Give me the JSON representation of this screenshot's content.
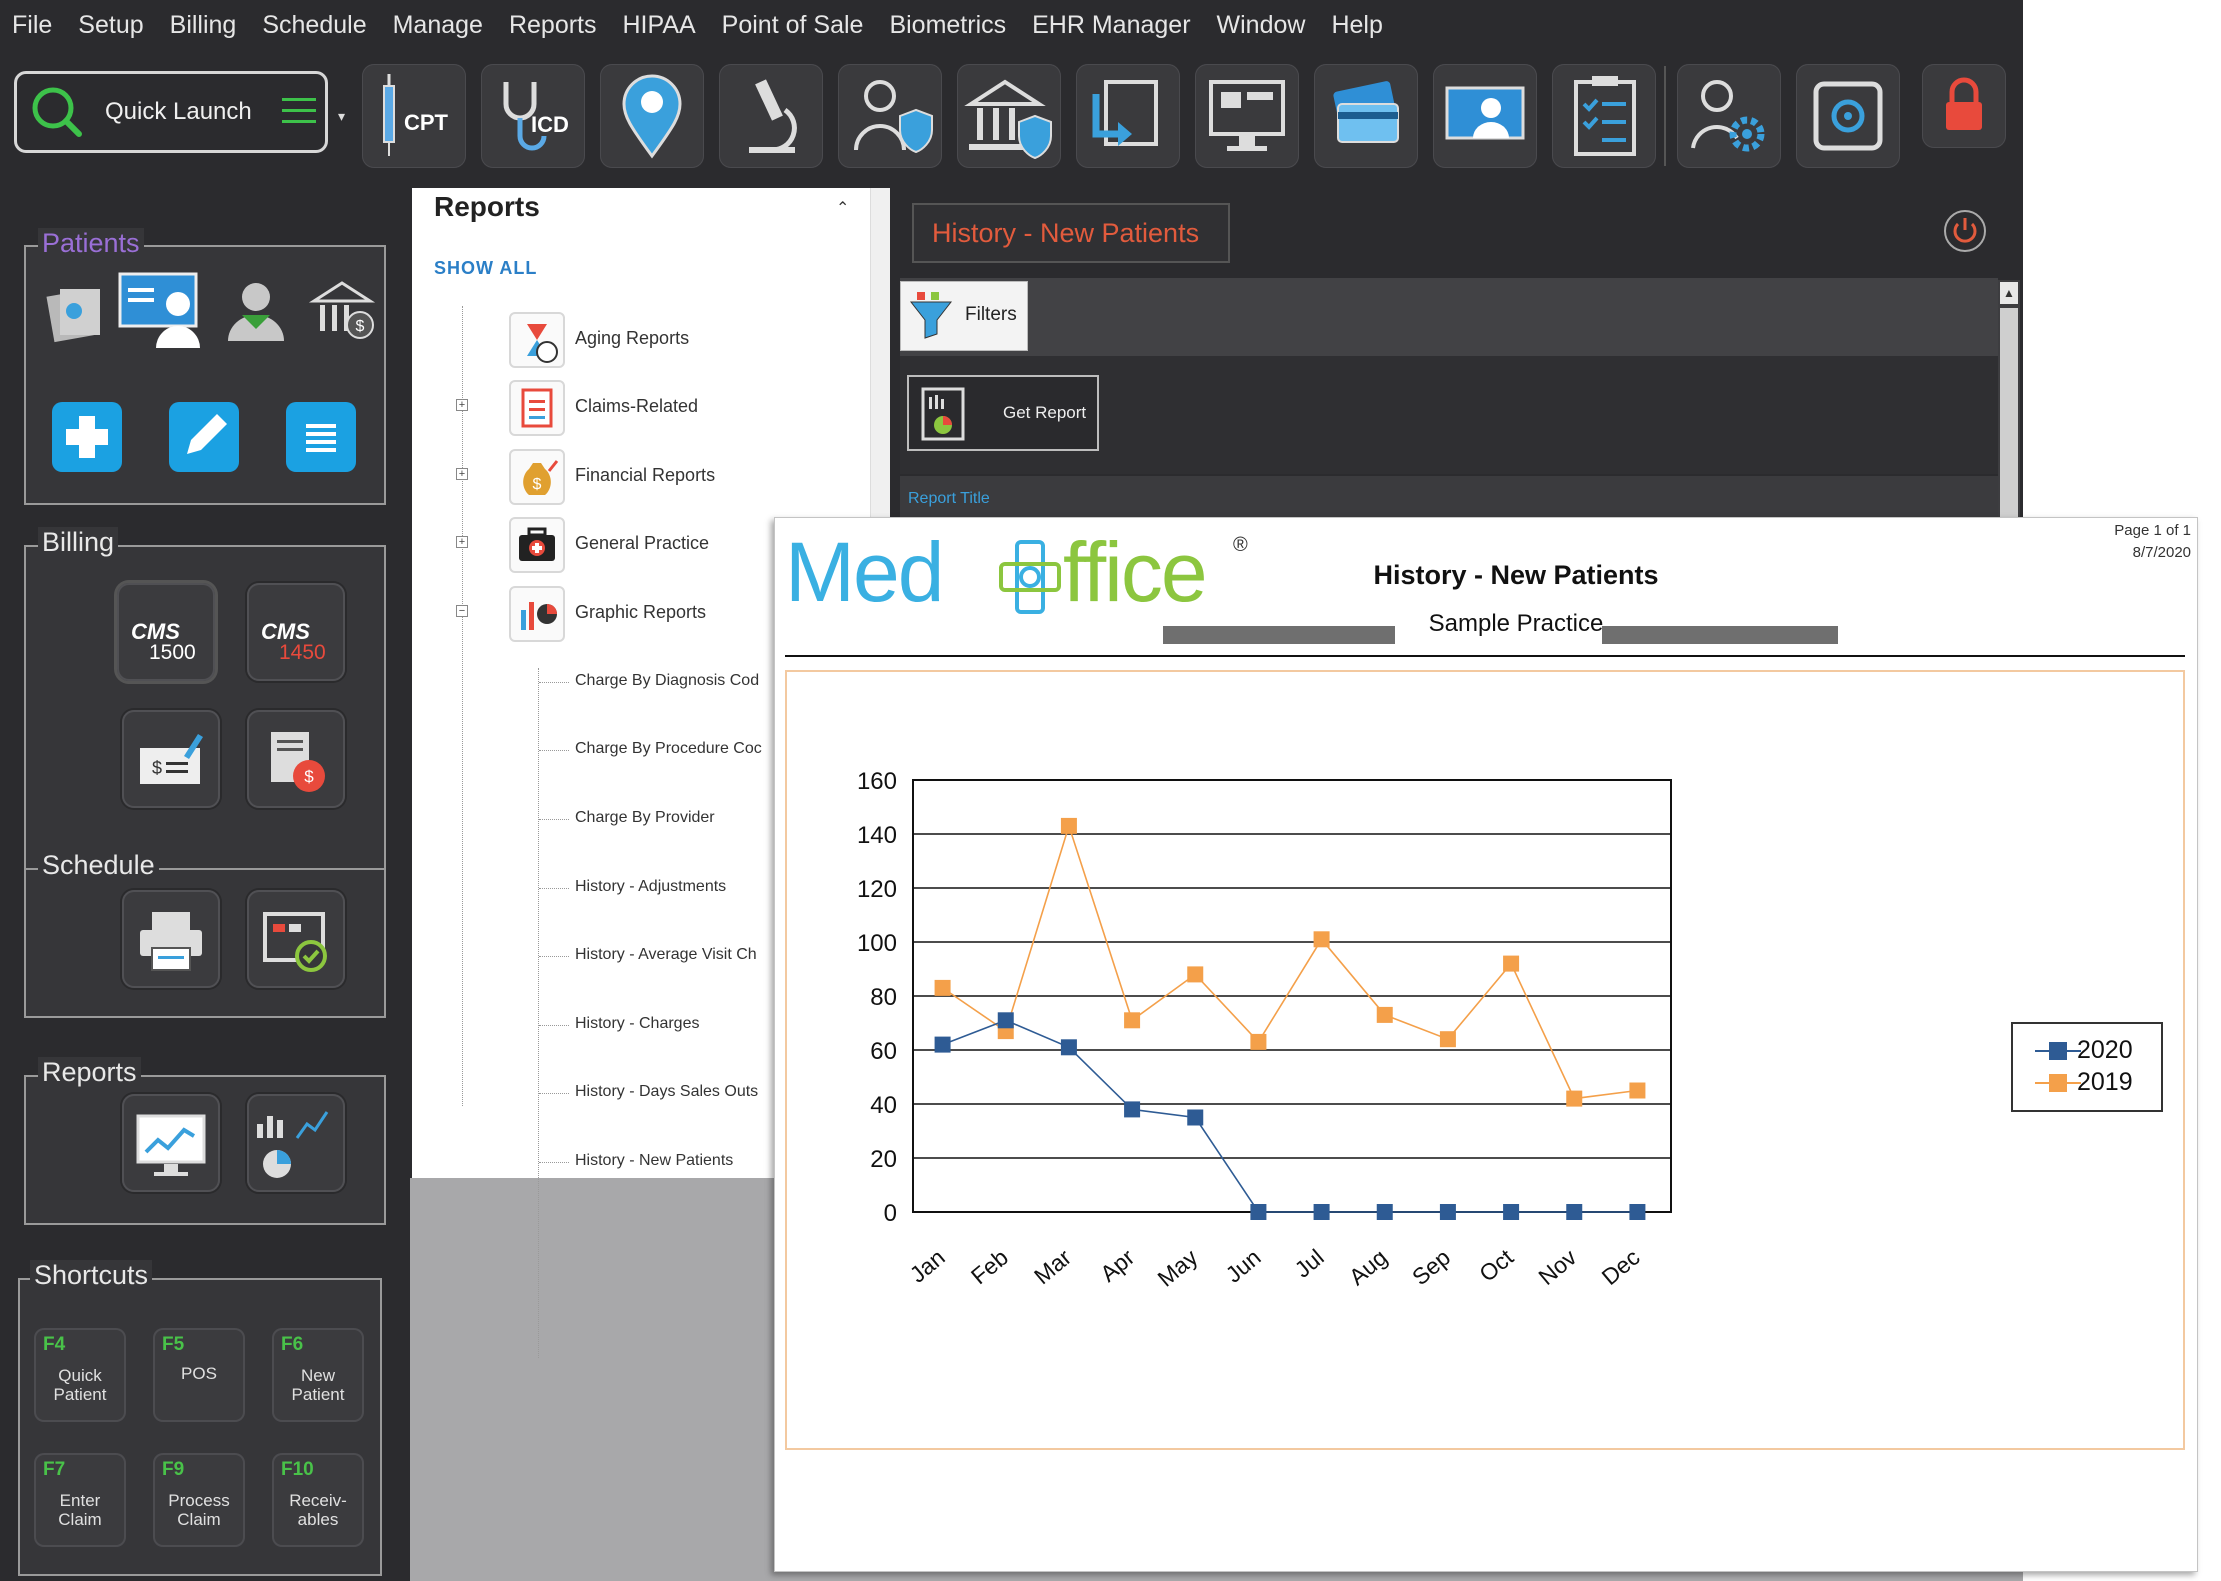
{
  "menu": [
    "File",
    "Setup",
    "Billing",
    "Schedule",
    "Manage",
    "Reports",
    "HIPAA",
    "Point of Sale",
    "Biometrics",
    "EHR Manager",
    "Window",
    "Help"
  ],
  "toolbar": {
    "quick_launch": "Quick Launch",
    "cpt": "CPT",
    "icd": "ICD"
  },
  "sidebar": {
    "patients": "Patients",
    "billing": "Billing",
    "cms1500": "1500",
    "cms1450": "1450",
    "cms": "CMS",
    "schedule": "Schedule",
    "reports": "Reports",
    "shortcuts": "Shortcuts",
    "shortcut_items": [
      {
        "key": "F4",
        "label1": "Quick",
        "label2": "Patient"
      },
      {
        "key": "F5",
        "label1": "POS",
        "label2": ""
      },
      {
        "key": "F6",
        "label1": "New",
        "label2": "Patient"
      },
      {
        "key": "F7",
        "label1": "Enter",
        "label2": "Claim"
      },
      {
        "key": "F9",
        "label1": "Process",
        "label2": "Claim"
      },
      {
        "key": "F10",
        "label1": "Receiv-",
        "label2": "ables"
      }
    ]
  },
  "reports_tree": {
    "title": "Reports",
    "show_all": "SHOW ALL",
    "categories": [
      "Aging Reports",
      "Claims-Related",
      "Financial Reports",
      "General Practice",
      "Graphic Reports"
    ],
    "leaves": [
      "Charge By Diagnosis Cod",
      "Charge By Procedure Coc",
      "Charge By Provider",
      "History - Adjustments",
      "History - Average Visit Ch",
      "History - Charges",
      "History - Days Sales Outs",
      "History - New Patients"
    ]
  },
  "report_panel": {
    "title": "History - New Patients",
    "filters": "Filters",
    "get_report": "Get Report",
    "report_title_label": "Report Title"
  },
  "document": {
    "logo_med": "Med",
    "logo_office": "ffice",
    "logo_reg": "®",
    "title": "History - New Patients",
    "subtitle": "Sample Practice",
    "page": "Page 1 of 1",
    "date": "8/7/2020"
  },
  "colors": {
    "series_2020": "#2e5b94",
    "series_2019": "#f4a04a",
    "accent_title": "#e25b3d",
    "logo_blue": "#3ab0e2",
    "logo_green": "#8cc63f"
  },
  "chart_data": {
    "type": "line",
    "categories": [
      "Jan",
      "Feb",
      "Mar",
      "Apr",
      "May",
      "Jun",
      "Jul",
      "Aug",
      "Sep",
      "Oct",
      "Nov",
      "Dec"
    ],
    "series": [
      {
        "name": "2020",
        "values": [
          62,
          71,
          61,
          38,
          35,
          0,
          0,
          0,
          0,
          0,
          0,
          0
        ]
      },
      {
        "name": "2019",
        "values": [
          83,
          67,
          143,
          71,
          88,
          63,
          101,
          73,
          64,
          92,
          42,
          45
        ]
      }
    ],
    "ylim": [
      0,
      160
    ],
    "yticks": [
      0,
      20,
      40,
      60,
      80,
      100,
      120,
      140,
      160
    ],
    "grid": true,
    "legend": "right"
  }
}
